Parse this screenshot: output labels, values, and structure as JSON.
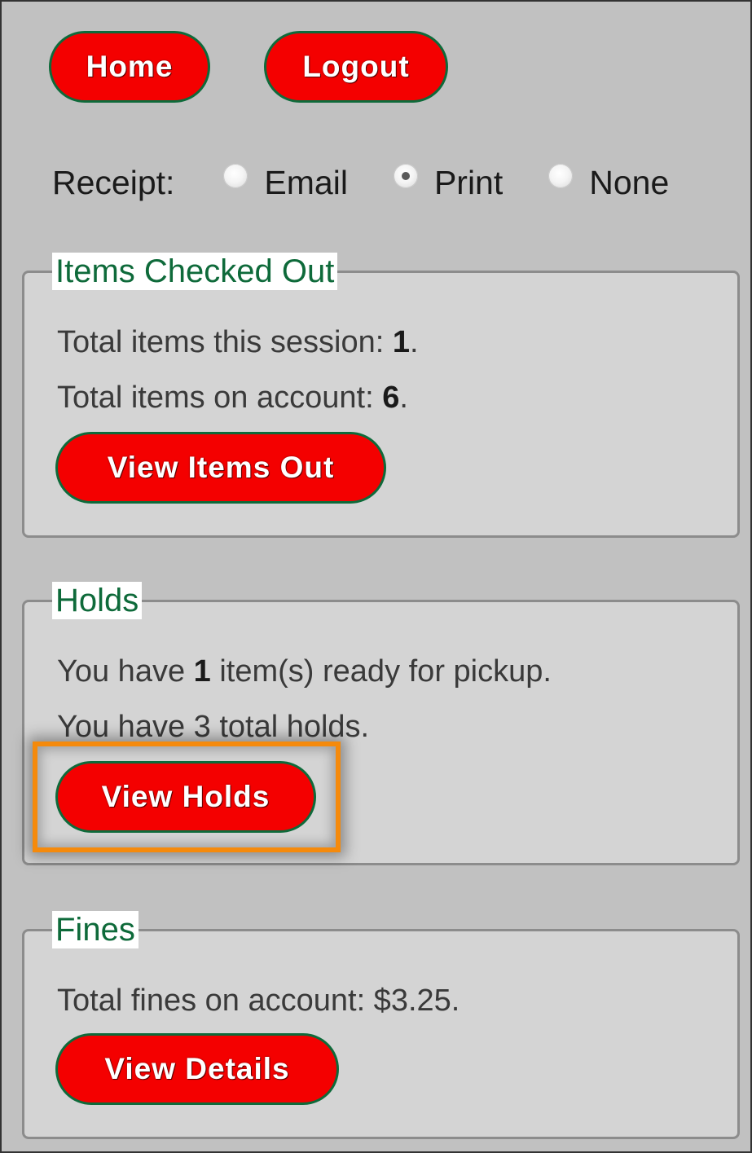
{
  "nav": {
    "home_label": "Home",
    "logout_label": "Logout"
  },
  "receipt": {
    "label": "Receipt:",
    "options": [
      {
        "label": "Email",
        "selected": false
      },
      {
        "label": "Print",
        "selected": true
      },
      {
        "label": "None",
        "selected": false
      }
    ]
  },
  "items_checked_out": {
    "title": "Items Checked Out",
    "session_prefix": "Total items this session: ",
    "session_count": "1",
    "account_prefix": "Total items on account: ",
    "account_count": "6",
    "suffix": ".",
    "button_label": "View Items Out"
  },
  "holds": {
    "title": "Holds",
    "ready_prefix": "You have ",
    "ready_count": "1",
    "ready_suffix": " item(s) ready for pickup.",
    "total_text": "You have 3 total holds.",
    "button_label": "View Holds"
  },
  "fines": {
    "title": "Fines",
    "total_prefix": "Total fines on account: $3.",
    "total_cents": "25",
    "suffix": ".",
    "button_label": "View Details"
  },
  "colors": {
    "button_bg": "#f40000",
    "button_border": "#0e6a3a",
    "legend_text": "#0e6a3a",
    "highlight": "#f58a0c",
    "page_bg": "#c1c1c1"
  }
}
